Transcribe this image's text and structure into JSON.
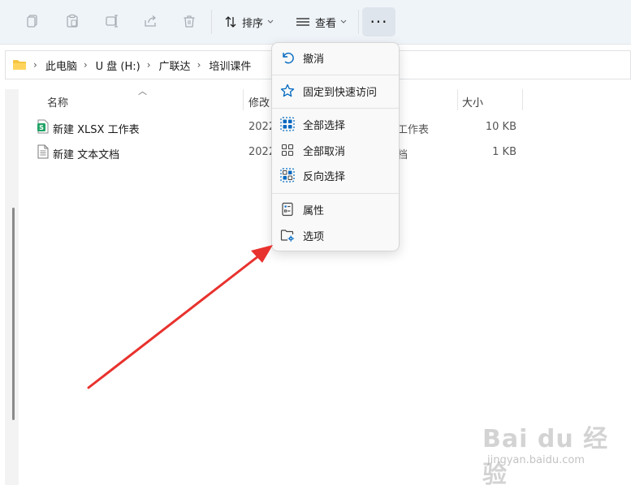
{
  "toolbar": {
    "icons": [
      "copy-icon",
      "paste-icon",
      "rename-icon",
      "share-icon",
      "delete-icon"
    ],
    "sort_label": "排序",
    "view_label": "查看",
    "more_label": "···"
  },
  "address": {
    "crumbs": [
      {
        "label": "此电脑"
      },
      {
        "label": "U 盘 (H:)"
      },
      {
        "label": "广联达"
      },
      {
        "label": "培训课件"
      }
    ]
  },
  "columns": {
    "name": "名称",
    "modified": "修改日",
    "size": "大小"
  },
  "files": [
    {
      "name": "新建 XLSX 工作表",
      "date": "2022",
      "type": "工作表",
      "size": "10 KB",
      "icon": "xlsx-file-icon"
    },
    {
      "name": "新建 文本文档",
      "date": "2022",
      "type": "档",
      "size": "1 KB",
      "icon": "text-file-icon"
    }
  ],
  "menu": {
    "items": [
      {
        "label": "撤消",
        "icon": "undo-icon"
      },
      {
        "label": "固定到快速访问",
        "icon": "star-icon"
      },
      {
        "label": "全部选择",
        "icon": "select-all-icon"
      },
      {
        "label": "全部取消",
        "icon": "select-none-icon"
      },
      {
        "label": "反向选择",
        "icon": "invert-selection-icon"
      },
      {
        "label": "属性",
        "icon": "properties-icon"
      },
      {
        "label": "选项",
        "icon": "folder-options-icon"
      }
    ]
  },
  "colors": {
    "accent": "#0067c0",
    "arrow": "#e8322e",
    "toolbar_bg": "#eff4f9"
  },
  "watermark": {
    "line1": "Bai du 经验",
    "line2": "jingyan.baidu.com"
  }
}
